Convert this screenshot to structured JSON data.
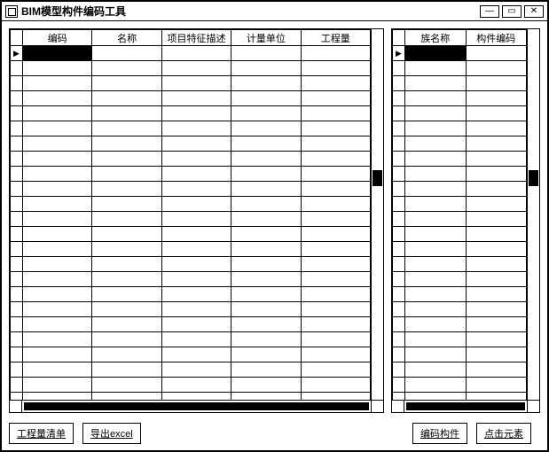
{
  "window": {
    "title": "BIM模型构件编码工具"
  },
  "leftGrid": {
    "columns": [
      "编码",
      "名称",
      "项目特征描述",
      "计量单位",
      "工程量"
    ],
    "rowCount": 24
  },
  "rightGrid": {
    "columns": [
      "族名称",
      "构件编码"
    ],
    "rowCount": 24
  },
  "buttons": {
    "b1": "工程量清单",
    "b2": "导出excel",
    "b3": "编码构件",
    "b4": "点击元素"
  }
}
